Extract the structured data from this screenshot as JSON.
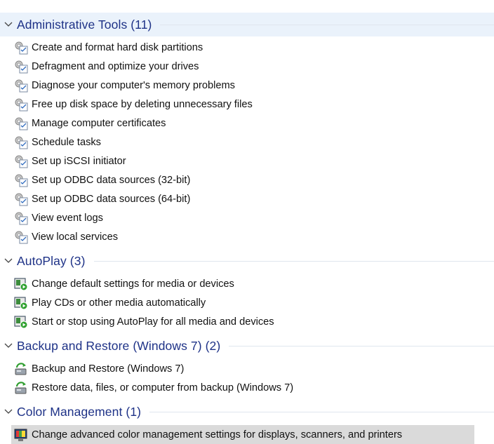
{
  "colors": {
    "group_title": "#1e3287",
    "selected_header_bg": "#eaf2fb",
    "hover_row_bg": "#dadada"
  },
  "groups": [
    {
      "title": "Administrative Tools (11)",
      "expanded": true,
      "icon": "admin-tools-icon",
      "items": [
        "Create and format hard disk partitions",
        "Defragment and optimize your drives",
        "Diagnose your computer's memory problems",
        "Free up disk space by deleting unnecessary files",
        "Manage computer certificates",
        "Schedule tasks",
        "Set up iSCSI initiator",
        "Set up ODBC data sources (32-bit)",
        "Set up ODBC data sources (64-bit)",
        "View event logs",
        "View local services"
      ]
    },
    {
      "title": "AutoPlay (3)",
      "expanded": true,
      "icon": "autoplay-icon",
      "items": [
        "Change default settings for media or devices",
        "Play CDs or other media automatically",
        "Start or stop using AutoPlay for all media and devices"
      ]
    },
    {
      "title": "Backup and Restore (Windows 7) (2)",
      "expanded": true,
      "icon": "backup-restore-icon",
      "items": [
        "Backup and Restore (Windows 7)",
        "Restore data, files, or computer from backup (Windows 7)"
      ]
    },
    {
      "title": "Color Management (1)",
      "expanded": true,
      "icon": "color-management-icon",
      "items": [
        "Change advanced color management settings for displays, scanners, and printers"
      ]
    }
  ]
}
